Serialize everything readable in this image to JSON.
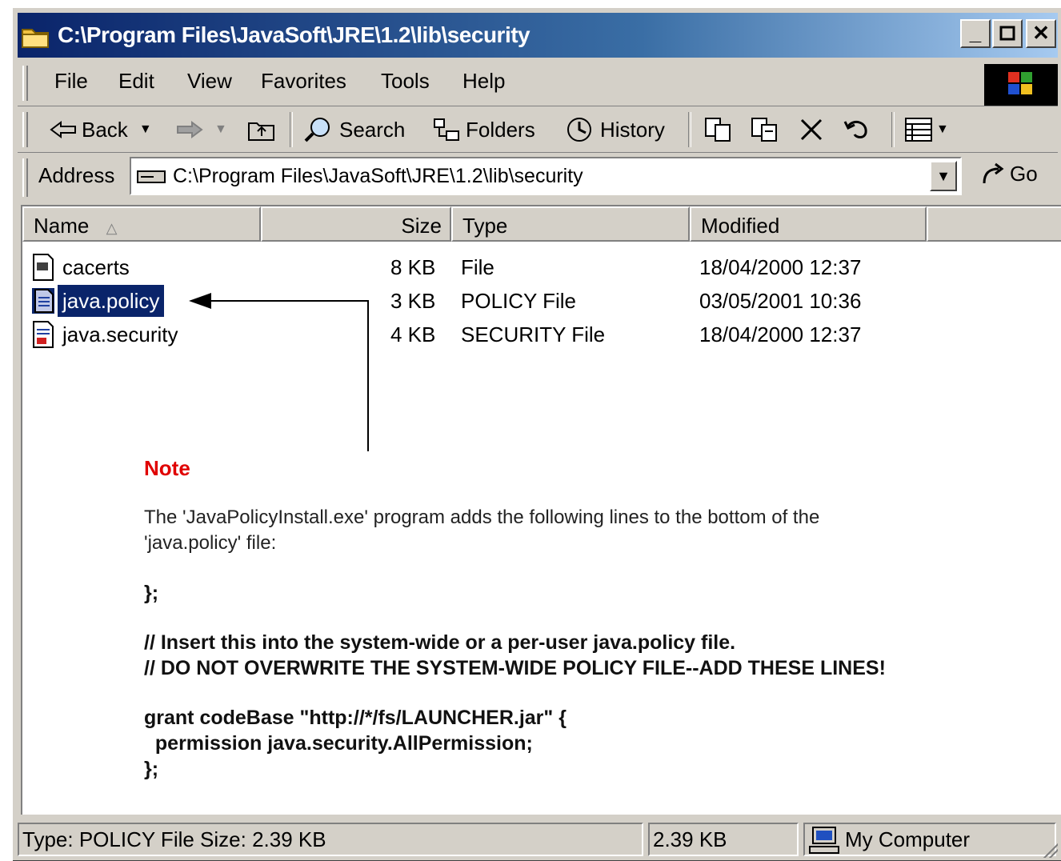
{
  "window": {
    "title": "C:\\Program Files\\JavaSoft\\JRE\\1.2\\lib\\security"
  },
  "menu": {
    "file": "File",
    "edit": "Edit",
    "view": "View",
    "favorites": "Favorites",
    "tools": "Tools",
    "help": "Help"
  },
  "toolbar": {
    "back": "Back",
    "search": "Search",
    "folders": "Folders",
    "history": "History"
  },
  "address": {
    "label": "Address",
    "value": "C:\\Program Files\\JavaSoft\\JRE\\1.2\\lib\\security",
    "go": "Go"
  },
  "columns": {
    "name": "Name",
    "size": "Size",
    "type": "Type",
    "modified": "Modified"
  },
  "files": [
    {
      "name": "cacerts",
      "size": "8 KB",
      "type": "File",
      "modified": "18/04/2000 12:37"
    },
    {
      "name": "java.policy",
      "size": "3 KB",
      "type": "POLICY File",
      "modified": "03/05/2001 10:36"
    },
    {
      "name": "java.security",
      "size": "4 KB",
      "type": "SECURITY File",
      "modified": "18/04/2000 12:37"
    }
  ],
  "note": {
    "title": "Note",
    "line1": "The 'JavaPolicyInstall.exe' program adds the following lines to the bottom of the",
    "line2": "'java.policy' file:",
    "closing": "};",
    "comment1": "// Insert this into the system-wide or a per-user java.policy file.",
    "comment2": "// DO NOT OVERWRITE THE SYSTEM-WIDE POLICY FILE--ADD THESE LINES!",
    "code1": "grant codeBase \"http://*/fs/LAUNCHER.jar\" {",
    "code2": "  permission java.security.AllPermission;",
    "code3": "};"
  },
  "status": {
    "info": "Type: POLICY File Size: 2.39 KB",
    "size": "2.39 KB",
    "zone": "My Computer"
  },
  "colors": {
    "title_start": "#0a246a",
    "selection": "#0a246a",
    "note_title": "#e00000"
  }
}
